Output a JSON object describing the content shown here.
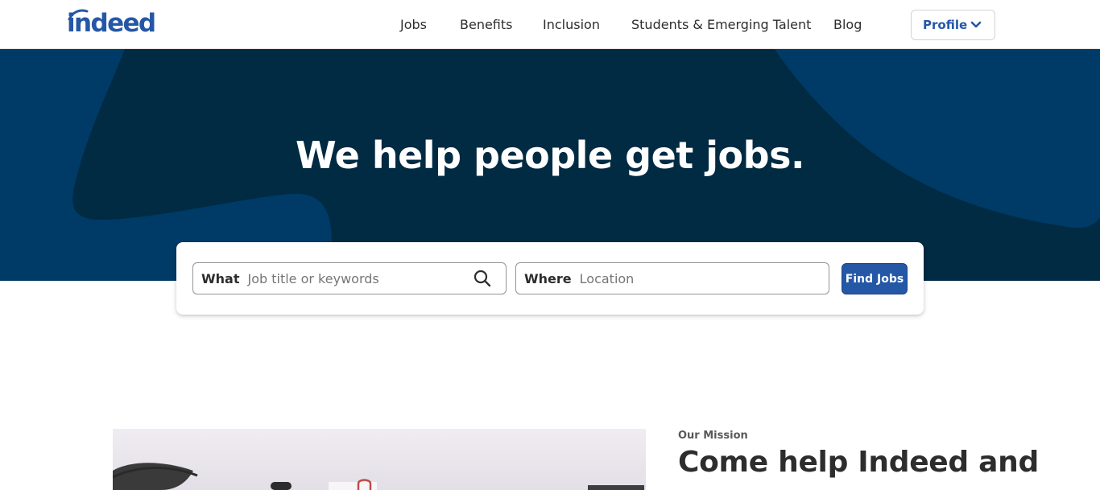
{
  "header": {
    "logo_text": "indeed",
    "nav": [
      "Jobs",
      "Benefits",
      "Inclusion",
      "Students & Emerging Talent",
      "Blog"
    ],
    "profile_label": "Profile"
  },
  "hero": {
    "title": "We help people get jobs."
  },
  "search": {
    "what_label": "What",
    "what_placeholder": "Job title or keywords",
    "where_label": "Where",
    "where_placeholder": "Location",
    "button_label": "Find Jobs"
  },
  "mission": {
    "eyebrow": "Our Mission",
    "title": "Come help Indeed and"
  },
  "colors": {
    "brand": "#2557a7",
    "hero_bg": "#012a43",
    "hero_shape": "#003a66"
  },
  "icons": {
    "profile_chevron": "chevron-down-icon",
    "search": "magnifier-icon"
  }
}
